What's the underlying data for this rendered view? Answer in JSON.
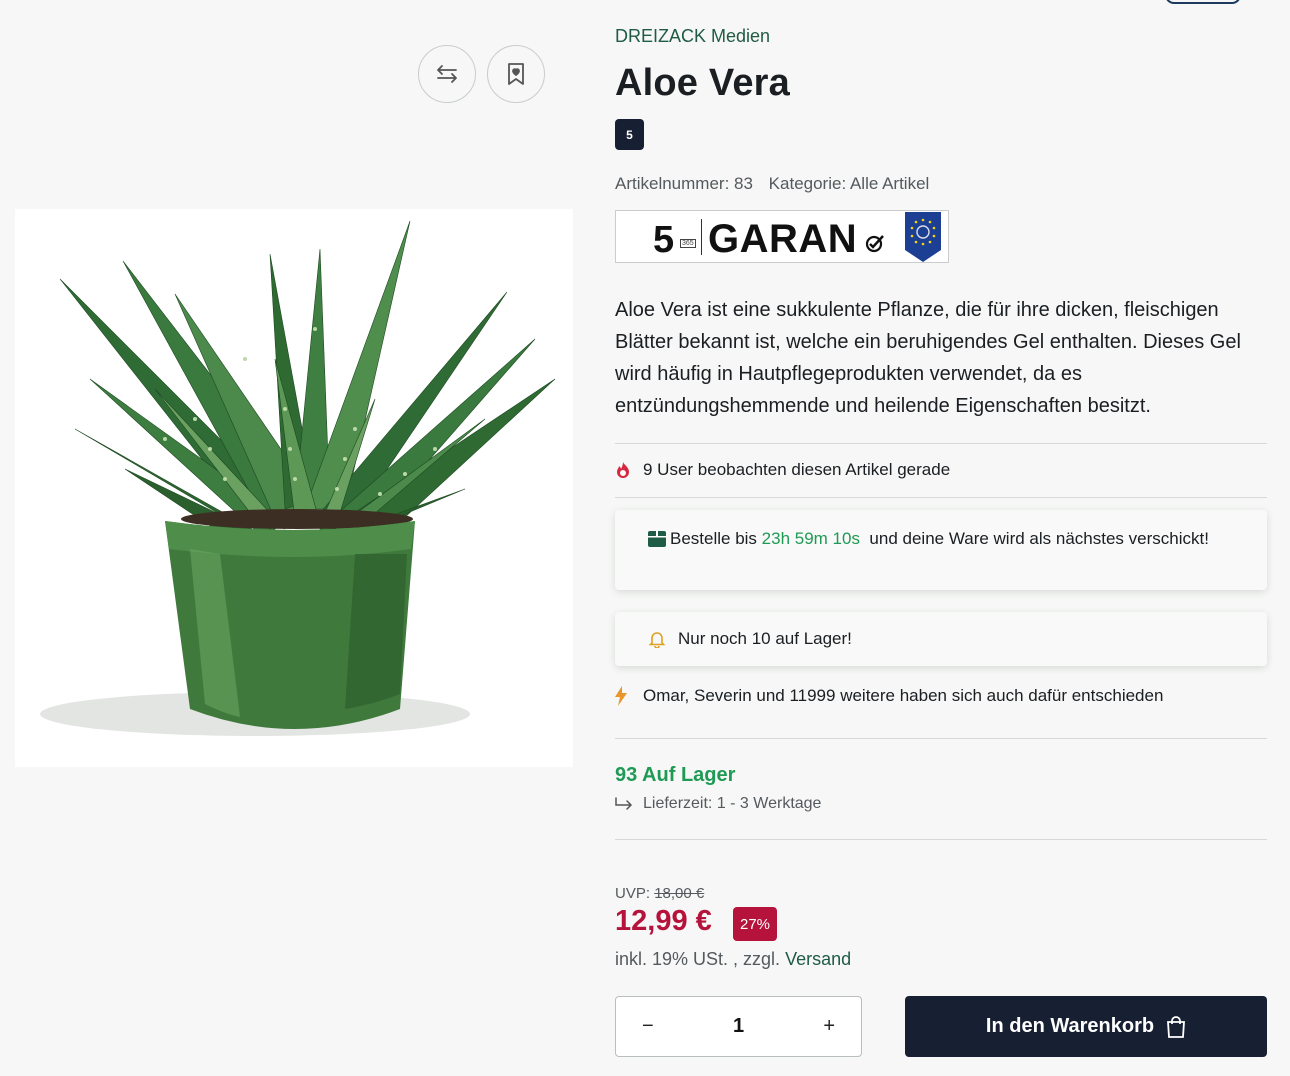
{
  "product": {
    "brand": "DREIZACK Medien",
    "title": "Aloe Vera",
    "badge": "5",
    "article_number": "Artikelnummer: 83",
    "category": "Kategorie: Alle Artikel",
    "description": "Aloe Vera ist eine sukkulente Pflanze, die für ihre dicken, fleischigen Blätter bekannt ist, welche ein beruhigendes Gel enthalten. Dieses Gel wird häufig in Hautpflegeprodukten verwendet, da es entzündungshemmende und heilende Eigenschaften besitzt."
  },
  "guarantee": {
    "number": "5",
    "sub": "365",
    "text": "GARAN"
  },
  "watchers": {
    "text": "9 User beobachten diesen Artikel gerade",
    "icon": "fire-icon"
  },
  "order_timer": {
    "prefix": "Bestelle bis",
    "timer": "23h 59m 10s",
    "suffix": "und deine Ware wird als nächstes verschickt!",
    "icon": "box-icon"
  },
  "stock_alert": {
    "text": "Nur noch 10 auf Lager!",
    "icon": "bell-icon"
  },
  "social_proof": {
    "text": "Omar, Severin und 11999 weitere haben sich auch dafür entschieden",
    "icon": "bolt-icon"
  },
  "availability": {
    "stock": "93 Auf Lager",
    "delivery": "Lieferzeit: 1 - 3 Werktage"
  },
  "pricing": {
    "uvp_label": "UVP:",
    "uvp_value": "18,00 €",
    "price": "12,99 €",
    "discount": "27%",
    "tax_text": "inkl. 19% USt. , zzgl.",
    "shipping_link": "Versand"
  },
  "quantity": {
    "value": "1",
    "minus": "−",
    "plus": "+"
  },
  "cart": {
    "label": "In den Warenkorb",
    "icon": "shopping-bag-icon"
  },
  "colors": {
    "accent": "#1f9a54",
    "brand_link": "#1f5b45",
    "price": "#b5133b",
    "dark": "#172032"
  }
}
